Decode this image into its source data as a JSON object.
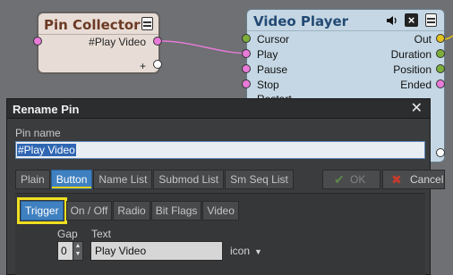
{
  "pin_collector": {
    "title": "Pin Collector",
    "output_pin_label": "#Play Video",
    "add_label": "+"
  },
  "video_player": {
    "title": "Video Player",
    "inputs": [
      "Cursor",
      "Play",
      "Pause",
      "Stop",
      "Restart"
    ],
    "outputs": [
      "Out",
      "Duration",
      "Position",
      "Ended"
    ]
  },
  "dialog": {
    "title": "Rename Pin",
    "close_label": "✕",
    "field_label": "Pin name",
    "pin_name_value": "#Play Video",
    "tabs": [
      "Plain",
      "Button",
      "Name List",
      "Submod List",
      "Sm Seq List"
    ],
    "active_tab": "Button",
    "ok_label": "OK",
    "cancel_label": "Cancel",
    "subtabs": [
      "Trigger",
      "On / Off",
      "Radio",
      "Bit Flags",
      "Video"
    ],
    "active_subtab": "Trigger",
    "gap_label": "Gap",
    "gap_value": "0",
    "text_label": "Text",
    "text_value": "Play Video",
    "icon_label": "icon"
  },
  "colors": {
    "highlight": "#f0e021",
    "active_tab": "#3f80c0",
    "wire": "#e87ad8"
  },
  "icons": [
    "menu-icon",
    "speaker-icon",
    "close-icon",
    "check-icon",
    "x-icon",
    "caret-down-icon"
  ]
}
